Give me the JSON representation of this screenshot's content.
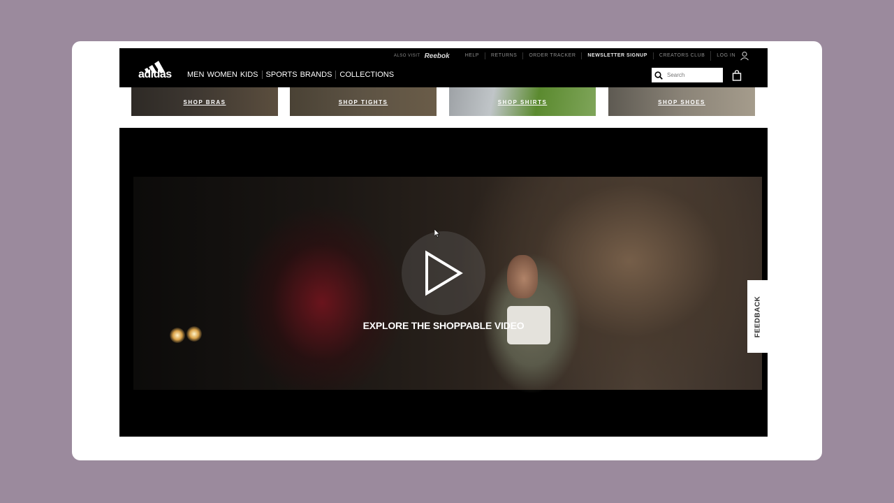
{
  "brand": {
    "logo_text": "adidas"
  },
  "topbar": {
    "also_visit_label": "ALSO VISIT",
    "also_visit_brand": "Reebok",
    "links": [
      {
        "label": "HELP",
        "bold": false
      },
      {
        "label": "RETURNS",
        "bold": false
      },
      {
        "label": "ORDER TRACKER",
        "bold": false
      },
      {
        "label": "NEWSLETTER SIGNUP",
        "bold": true
      },
      {
        "label": "CREATORS CLUB",
        "bold": false
      }
    ],
    "login_label": "LOG IN"
  },
  "nav": {
    "items": [
      "MEN",
      "WOMEN",
      "KIDS",
      "SPORTS",
      "BRANDS",
      "COLLECTIONS"
    ]
  },
  "search": {
    "placeholder": "Search",
    "value": ""
  },
  "tiles": [
    {
      "label": "SHOP BRAS"
    },
    {
      "label": "SHOP TIGHTS"
    },
    {
      "label": "SHOP SHIRTS"
    },
    {
      "label": "SHOP SHOES"
    }
  ],
  "video": {
    "cta": "EXPLORE THE SHOPPABLE VIDEO"
  },
  "feedback": {
    "label": "FEEDBACK"
  },
  "colors": {
    "page_bg": "#9b8a9d",
    "header_bg": "#000000",
    "text": "#ffffff"
  },
  "icons": [
    "adidas-logo",
    "user-icon",
    "search-icon",
    "shopping-bag-icon",
    "play-icon"
  ]
}
